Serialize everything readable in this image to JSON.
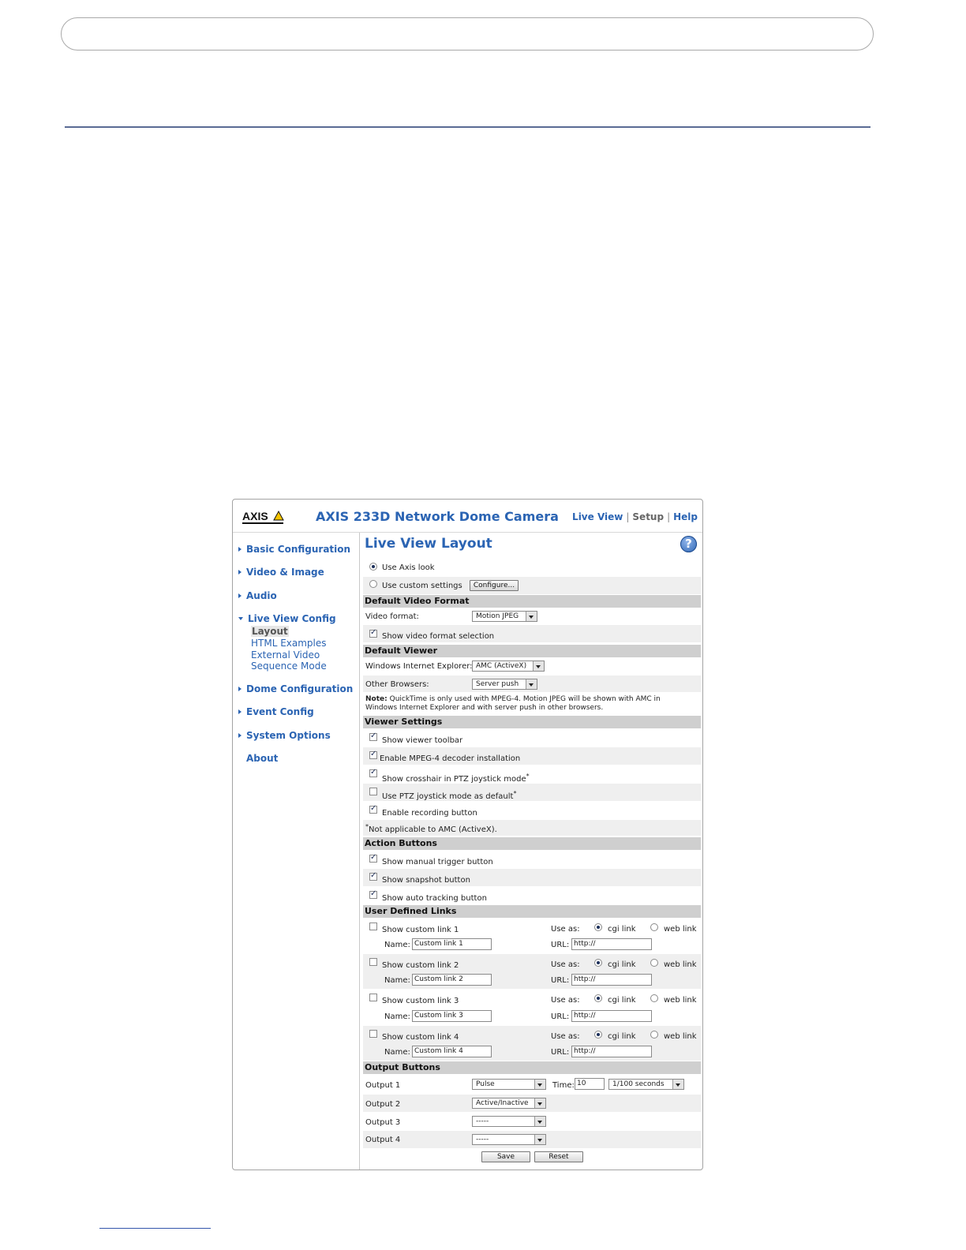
{
  "header": {
    "product_title": "AXIS 233D Network Dome Camera",
    "logo_text": "AXIS",
    "links": {
      "live_view": "Live View",
      "setup": "Setup",
      "help": "Help",
      "separator": "|"
    }
  },
  "sidebar": {
    "items": [
      {
        "label": "Basic Configuration"
      },
      {
        "label": "Video & Image"
      },
      {
        "label": "Audio"
      },
      {
        "label": "Live View Config"
      },
      {
        "label": "Dome Configuration"
      },
      {
        "label": "Event Config"
      },
      {
        "label": "System Options"
      },
      {
        "label": "About"
      }
    ],
    "live_view_sub": [
      "Layout",
      "HTML Examples",
      "External Video",
      "Sequence Mode"
    ]
  },
  "main": {
    "title": "Live View Layout",
    "help_icon": "question-icon",
    "look": {
      "use_axis_look": "Use Axis look",
      "use_custom": "Use custom settings",
      "configure_btn": "Configure...",
      "selected": "Use Axis look"
    },
    "default_video_format": {
      "heading": "Default Video Format",
      "label": "Video format:",
      "value": "Motion JPEG",
      "show_selection": "Show video format selection",
      "show_selection_checked": true
    },
    "default_viewer": {
      "heading": "Default Viewer",
      "ie_label": "Windows Internet Explorer:",
      "ie_value": "AMC (ActiveX)",
      "other_label": "Other Browsers:",
      "other_value": "Server push",
      "note_bold": "Note:",
      "note_line1": "QuickTime is only used with MPEG-4. Motion JPEG will be shown with AMC in",
      "note_line2": "Windows Internet Explorer and with server push in other browsers."
    },
    "viewer_settings": {
      "heading": "Viewer Settings",
      "items": [
        {
          "label": "Show viewer toolbar",
          "checked": true
        },
        {
          "label": "Enable MPEG-4 decoder installation",
          "checked": true
        },
        {
          "label": "Show crosshair in PTZ joystick mode",
          "checked": true,
          "star": "*"
        },
        {
          "label": "Use PTZ joystick mode as default",
          "checked": false,
          "star": "*"
        },
        {
          "label": "Enable recording button",
          "checked": true
        }
      ],
      "footnote_star": "*",
      "footnote": "Not applicable to AMC (ActiveX)."
    },
    "action_buttons": {
      "heading": "Action Buttons",
      "items": [
        {
          "label": "Show manual trigger button",
          "checked": true
        },
        {
          "label": "Show snapshot button",
          "checked": true
        },
        {
          "label": "Show auto tracking button",
          "checked": true
        }
      ]
    },
    "user_links": {
      "heading": "User Defined Links",
      "use_as": "Use as:",
      "cgi": "cgi link",
      "web": "web link",
      "name_label": "Name:",
      "url_label": "URL:",
      "links": [
        {
          "show": "Show custom link 1",
          "name": "Custom link 1",
          "url": "http://"
        },
        {
          "show": "Show custom link 2",
          "name": "Custom link 2",
          "url": "http://"
        },
        {
          "show": "Show custom link 3",
          "name": "Custom link 3",
          "url": "http://"
        },
        {
          "show": "Show custom link 4",
          "name": "Custom link 4",
          "url": "http://"
        }
      ]
    },
    "output_buttons": {
      "heading": "Output Buttons",
      "outputs": [
        {
          "label": "Output 1",
          "value": "Pulse"
        },
        {
          "label": "Output 2",
          "value": "Active/Inactive"
        },
        {
          "label": "Output 3",
          "value": "-----"
        },
        {
          "label": "Output 4",
          "value": "-----"
        }
      ],
      "time_label": "Time:",
      "time_value": "10",
      "time_unit": "1/100 seconds"
    },
    "save_btn": "Save",
    "reset_btn": "Reset"
  },
  "colors": {
    "accent": "#2b64b3",
    "section_bg": "#cfcfcf",
    "alt_row": "#efefef"
  }
}
